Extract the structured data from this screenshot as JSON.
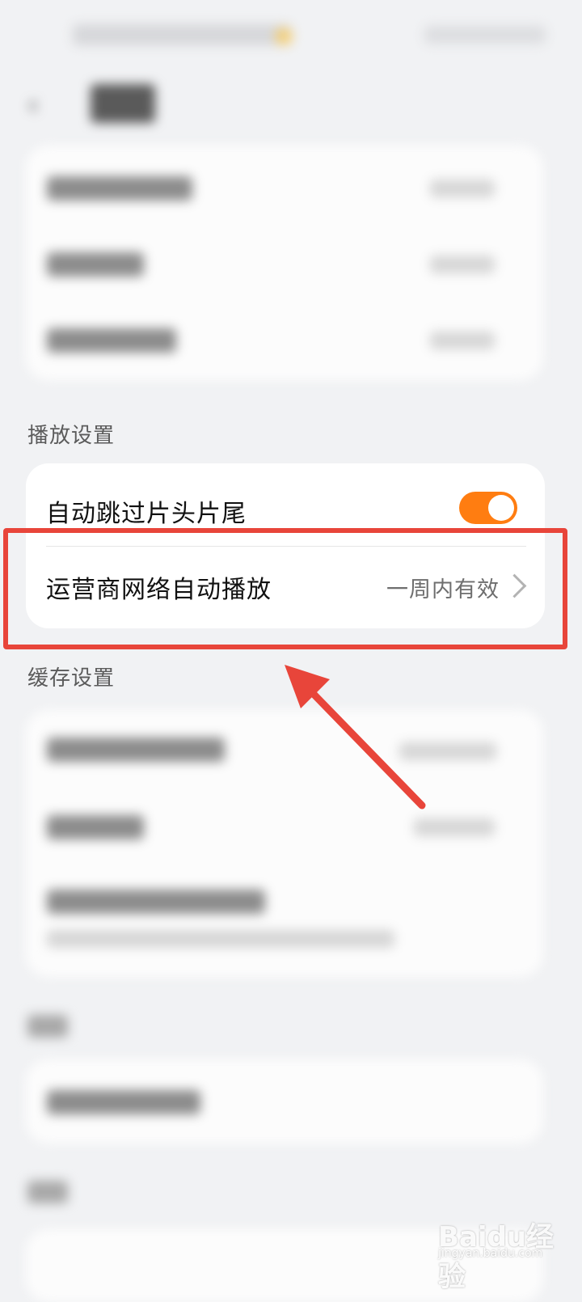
{
  "playback_settings": {
    "header": "播放设置",
    "skip_intro_outro": {
      "label": "自动跳过片头片尾",
      "enabled": true
    },
    "cellular_autoplay": {
      "label": "运营商网络自动播放",
      "value": "一周内有效"
    }
  },
  "cache_settings": {
    "header": "缓存设置"
  },
  "watermark": {
    "text": "Baidu经验",
    "sub": "jingyan.baidu.com"
  },
  "colors": {
    "toggle_on": "#ff7d11",
    "highlight": "#e8453a",
    "background": "#f1f2f4"
  }
}
